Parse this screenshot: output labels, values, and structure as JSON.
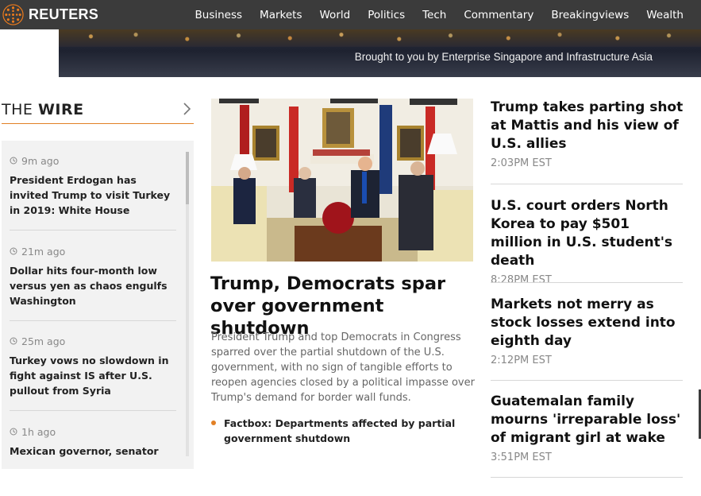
{
  "brand": {
    "name": "REUTERS"
  },
  "nav": {
    "items": [
      "Business",
      "Markets",
      "World",
      "Politics",
      "Tech",
      "Commentary",
      "Breakingviews",
      "Wealth"
    ]
  },
  "banner": {
    "text": "Brought to you by Enterprise Singapore and Infrastructure Asia"
  },
  "wire": {
    "title_prefix": "THE",
    "title_main": "WIRE",
    "items": [
      {
        "time": "9m ago",
        "text": "President Erdogan has invited Trump to visit Turkey in 2019: White House"
      },
      {
        "time": "21m ago",
        "text": "Dollar hits four-month low versus yen as chaos engulfs Washington"
      },
      {
        "time": "25m ago",
        "text": "Turkey vows no slowdown in fight against IS after U.S. pullout from Syria"
      },
      {
        "time": "1h ago",
        "text": "Mexican governor, senator"
      }
    ],
    "scroll_position": 0
  },
  "hero": {
    "title": "Trump, Democrats spar over government shutdown",
    "summary": "President Trump and top Democrats in Congress sparred over the partial shutdown of the U.S. government, with no sign of tangible efforts to reopen agencies closed by a political impasse over Trump's demand for border wall funds.",
    "factbox": "Factbox: Departments affected by partial government shutdown"
  },
  "stories": [
    {
      "title": "Trump takes parting shot at Mattis and his view of U.S. allies",
      "time": "2:03PM EST"
    },
    {
      "title": "U.S. court orders North Korea to pay $501 million in U.S. student's death",
      "time": "8:28PM EST"
    },
    {
      "title": "Markets not merry as stock losses extend into eighth day",
      "time": "2:12PM EST"
    },
    {
      "title": "Guatemalan family mourns 'irreparable loss' of migrant girl at wake",
      "time": "3:51PM EST"
    }
  ],
  "colors": {
    "accent": "#e28025",
    "topbar": "#3b3b3b",
    "wire_bg": "#f2f2f2"
  },
  "icons": {
    "logo": "reuters-logo-icon",
    "clock": "clock-icon",
    "chevron": "chevron-right-icon",
    "bullet": "bullet-icon"
  }
}
